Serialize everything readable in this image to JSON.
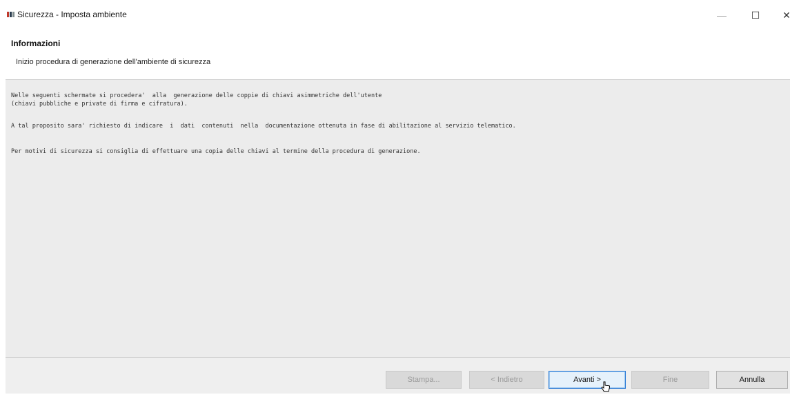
{
  "window": {
    "title": "Sicurezza - Imposta ambiente",
    "icon": "app-logo-icon",
    "controls": {
      "minimize": "—",
      "maximize": "☐",
      "close": "✕"
    }
  },
  "header": {
    "title": "Informazioni",
    "subtitle": "Inizio procedura di generazione dell'ambiente di sicurezza"
  },
  "content": {
    "paragraph1_line1": "Nelle seguenti schermate si procedera'  alla  generazione delle coppie di chiavi asimmetriche dell'utente",
    "paragraph1_line2": "(chiavi pubbliche e private di firma e cifratura).",
    "paragraph2": "A tal proposito sara' richiesto di indicare  i  dati  contenuti  nella  documentazione ottenuta in fase di abilitazione al servizio telematico.",
    "paragraph3": "Per motivi di sicurezza si consiglia di effettuare una copia delle chiavi al termine della procedura di generazione."
  },
  "buttons": {
    "stampa": "Stampa...",
    "indietro": "< Indietro",
    "avanti": "Avanti >",
    "fine": "Fine",
    "annulla": "Annulla"
  },
  "colors": {
    "content_bg": "#ececec",
    "focus_border": "#2b7bd6",
    "disabled_button": "#d9d9d9"
  }
}
